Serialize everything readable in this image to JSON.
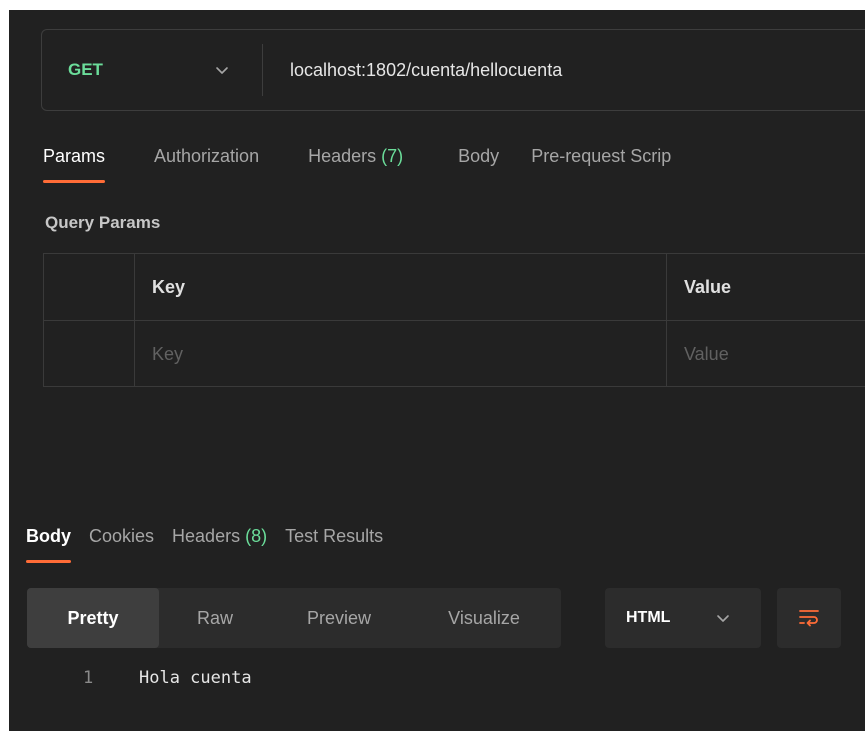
{
  "request": {
    "method": "GET",
    "url": "localhost:1802/cuenta/hellocuenta"
  },
  "request_tabs": [
    {
      "label": "Params",
      "count": "",
      "active": true
    },
    {
      "label": "Authorization",
      "count": ""
    },
    {
      "label": "Headers",
      "count": "(7)"
    },
    {
      "label": "Body",
      "count": ""
    },
    {
      "label": "Pre-request Scrip",
      "count": ""
    }
  ],
  "query_params": {
    "title": "Query Params",
    "columns": [
      "Key",
      "Value"
    ],
    "placeholders": {
      "key": "Key",
      "value": "Value"
    }
  },
  "response_tabs": [
    {
      "label": "Body",
      "count": "",
      "active": true
    },
    {
      "label": "Cookies",
      "count": ""
    },
    {
      "label": "Headers",
      "count": "(8)"
    },
    {
      "label": "Test Results",
      "count": ""
    }
  ],
  "view_modes": [
    {
      "label": "Pretty",
      "active": true
    },
    {
      "label": "Raw"
    },
    {
      "label": "Preview"
    },
    {
      "label": "Visualize"
    }
  ],
  "format": {
    "selected": "HTML"
  },
  "icons": {
    "method_dropdown": "chevron-down-icon",
    "format_dropdown": "chevron-down-icon",
    "wrap": "wrap-lines-icon"
  },
  "response_body": {
    "lines": [
      {
        "number": "1",
        "text": "Hola cuenta"
      }
    ]
  },
  "colors": {
    "background": "#212121",
    "accent": "#ff6c37",
    "method_get": "#6bdd9a",
    "count": "#6bdd9a"
  }
}
